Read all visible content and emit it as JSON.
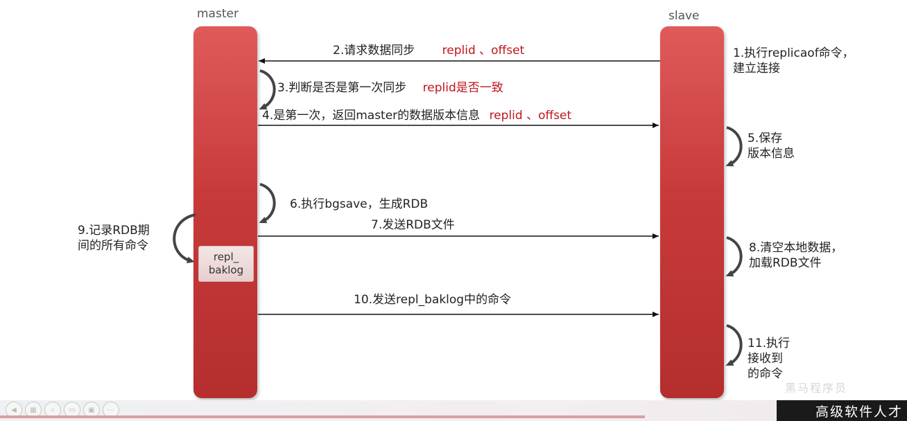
{
  "lanes": {
    "master": "master",
    "slave": "slave"
  },
  "steps": {
    "s1_line1": "1.执行replicaof命令，",
    "s1_line2": "建立连接",
    "s2_text": "2.请求数据同步",
    "s2_red": "replid 、offset",
    "s3_text": "3.判断是否是第一次同步",
    "s3_red": "replid是否一致",
    "s4_text": "4.是第一次，返回master的数据版本信息",
    "s4_red": "replid 、offset",
    "s5_line1": "5.保存",
    "s5_line2": "版本信息",
    "s6_text": "6.执行bgsave，生成RDB",
    "s7_text": "7.发送RDB文件",
    "s8_line1": "8.清空本地数据，",
    "s8_line2": "加载RDB文件",
    "s9_line1": "9.记录RDB期",
    "s9_line2": "间的所有命令",
    "s10_text": "10.发送repl_baklog中的命令",
    "s11_line1": "11.执行",
    "s11_line2": "接收到",
    "s11_line3": "的命令"
  },
  "backlog": {
    "line1": "repl_",
    "line2": "baklog"
  },
  "player": {
    "watermark": "高级软件人才",
    "watermark_faint": "黑马程序员",
    "controls": [
      "prev-icon",
      "grid-icon",
      "zoom-icon",
      "slides-icon",
      "screen-icon",
      "more-icon"
    ]
  },
  "colors": {
    "bar": "#c83a3a",
    "highlight": "#c0141b",
    "arrow": "#111111"
  }
}
